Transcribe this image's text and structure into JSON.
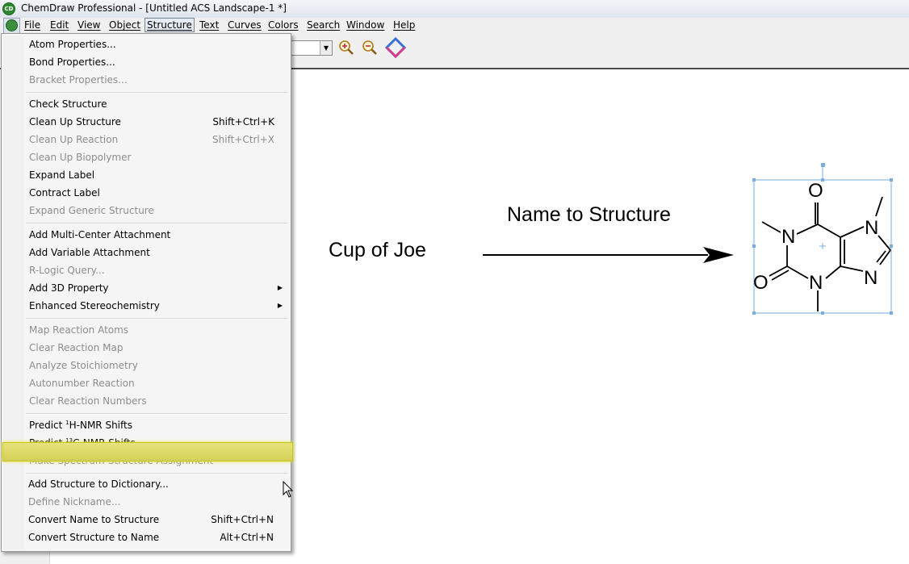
{
  "window": {
    "title": "ChemDraw Professional - [Untitled ACS Landscape-1 *]"
  },
  "menubar": {
    "items": [
      "File",
      "Edit",
      "View",
      "Object",
      "Structure",
      "Text",
      "Curves",
      "Colors",
      "Search",
      "Window",
      "Help"
    ],
    "active": "Structure"
  },
  "toolbar": {
    "zoom_in_icon": "zoom-in-icon",
    "zoom_out_icon": "zoom-out-icon",
    "app_logo_icon": "chemdraw-diamond-icon"
  },
  "structure_menu": {
    "groups": [
      [
        {
          "label": "Atom Properties...",
          "enabled": true
        },
        {
          "label": "Bond Properties...",
          "enabled": true
        },
        {
          "label": "Bracket Properties...",
          "enabled": false
        }
      ],
      [
        {
          "label": "Check Structure",
          "enabled": true
        },
        {
          "label": "Clean Up Structure",
          "shortcut": "Shift+Ctrl+K",
          "enabled": true
        },
        {
          "label": "Clean Up Reaction",
          "shortcut": "Shift+Ctrl+X",
          "enabled": false
        },
        {
          "label": "Clean Up Biopolymer",
          "enabled": false
        },
        {
          "label": "Expand Label",
          "enabled": true
        },
        {
          "label": "Contract Label",
          "enabled": true
        },
        {
          "label": "Expand Generic Structure",
          "enabled": false
        }
      ],
      [
        {
          "label": "Add Multi-Center Attachment",
          "enabled": true
        },
        {
          "label": "Add Variable Attachment",
          "enabled": true
        },
        {
          "label": "R-Logic Query...",
          "enabled": false
        },
        {
          "label": "Add 3D Property",
          "enabled": true,
          "submenu": true
        },
        {
          "label": "Enhanced Stereochemistry",
          "enabled": true,
          "submenu": true
        }
      ],
      [
        {
          "label": "Map Reaction Atoms",
          "enabled": false
        },
        {
          "label": "Clear Reaction Map",
          "enabled": false
        },
        {
          "label": "Analyze Stoichiometry",
          "enabled": false
        },
        {
          "label": "Autonumber Reaction",
          "enabled": false
        },
        {
          "label": "Clear Reaction Numbers",
          "enabled": false
        }
      ],
      [
        {
          "label_prefix": "Predict ",
          "label_sup": "1",
          "label_suffix": "H-NMR Shifts",
          "enabled": true
        },
        {
          "label_prefix": "Predict ",
          "label_sup": "13",
          "label_suffix": "C-NMR Shifts",
          "enabled": true
        },
        {
          "label": "Make Spectrum-Structure Assignment",
          "enabled": false
        }
      ],
      [
        {
          "label": "Add Structure to Dictionary...",
          "enabled": true,
          "highlighted": true
        },
        {
          "label": "Define Nickname...",
          "enabled": false
        },
        {
          "label": "Convert Name to Structure",
          "shortcut": "Shift+Ctrl+N",
          "enabled": true
        },
        {
          "label": "Convert Structure to Name",
          "shortcut": "Alt+Ctrl+N",
          "enabled": true
        }
      ]
    ]
  },
  "canvas": {
    "input_text": "Cup of Joe",
    "arrow_label": "Name to Structure",
    "atoms": {
      "O_top": "O",
      "O_left": "O",
      "N1": "N",
      "N3": "N",
      "N7": "N",
      "N9": "N"
    }
  }
}
